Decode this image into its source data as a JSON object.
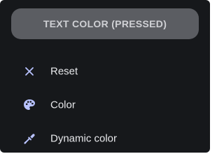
{
  "header": {
    "pressed_button_label": "TEXT COLOR (PRESSED)"
  },
  "menu": {
    "items": [
      {
        "label": "Reset",
        "icon": "close-icon"
      },
      {
        "label": "Color",
        "icon": "palette-icon"
      },
      {
        "label": "Dynamic color",
        "icon": "eyedropper-icon"
      }
    ]
  },
  "colors": {
    "panel_bg": "#16181b",
    "pressed_button_bg": "#5b5d62",
    "pressed_button_text": "#cfd0d4",
    "menu_text": "#e6e7ea",
    "icon_color": "#b8c2ff"
  }
}
